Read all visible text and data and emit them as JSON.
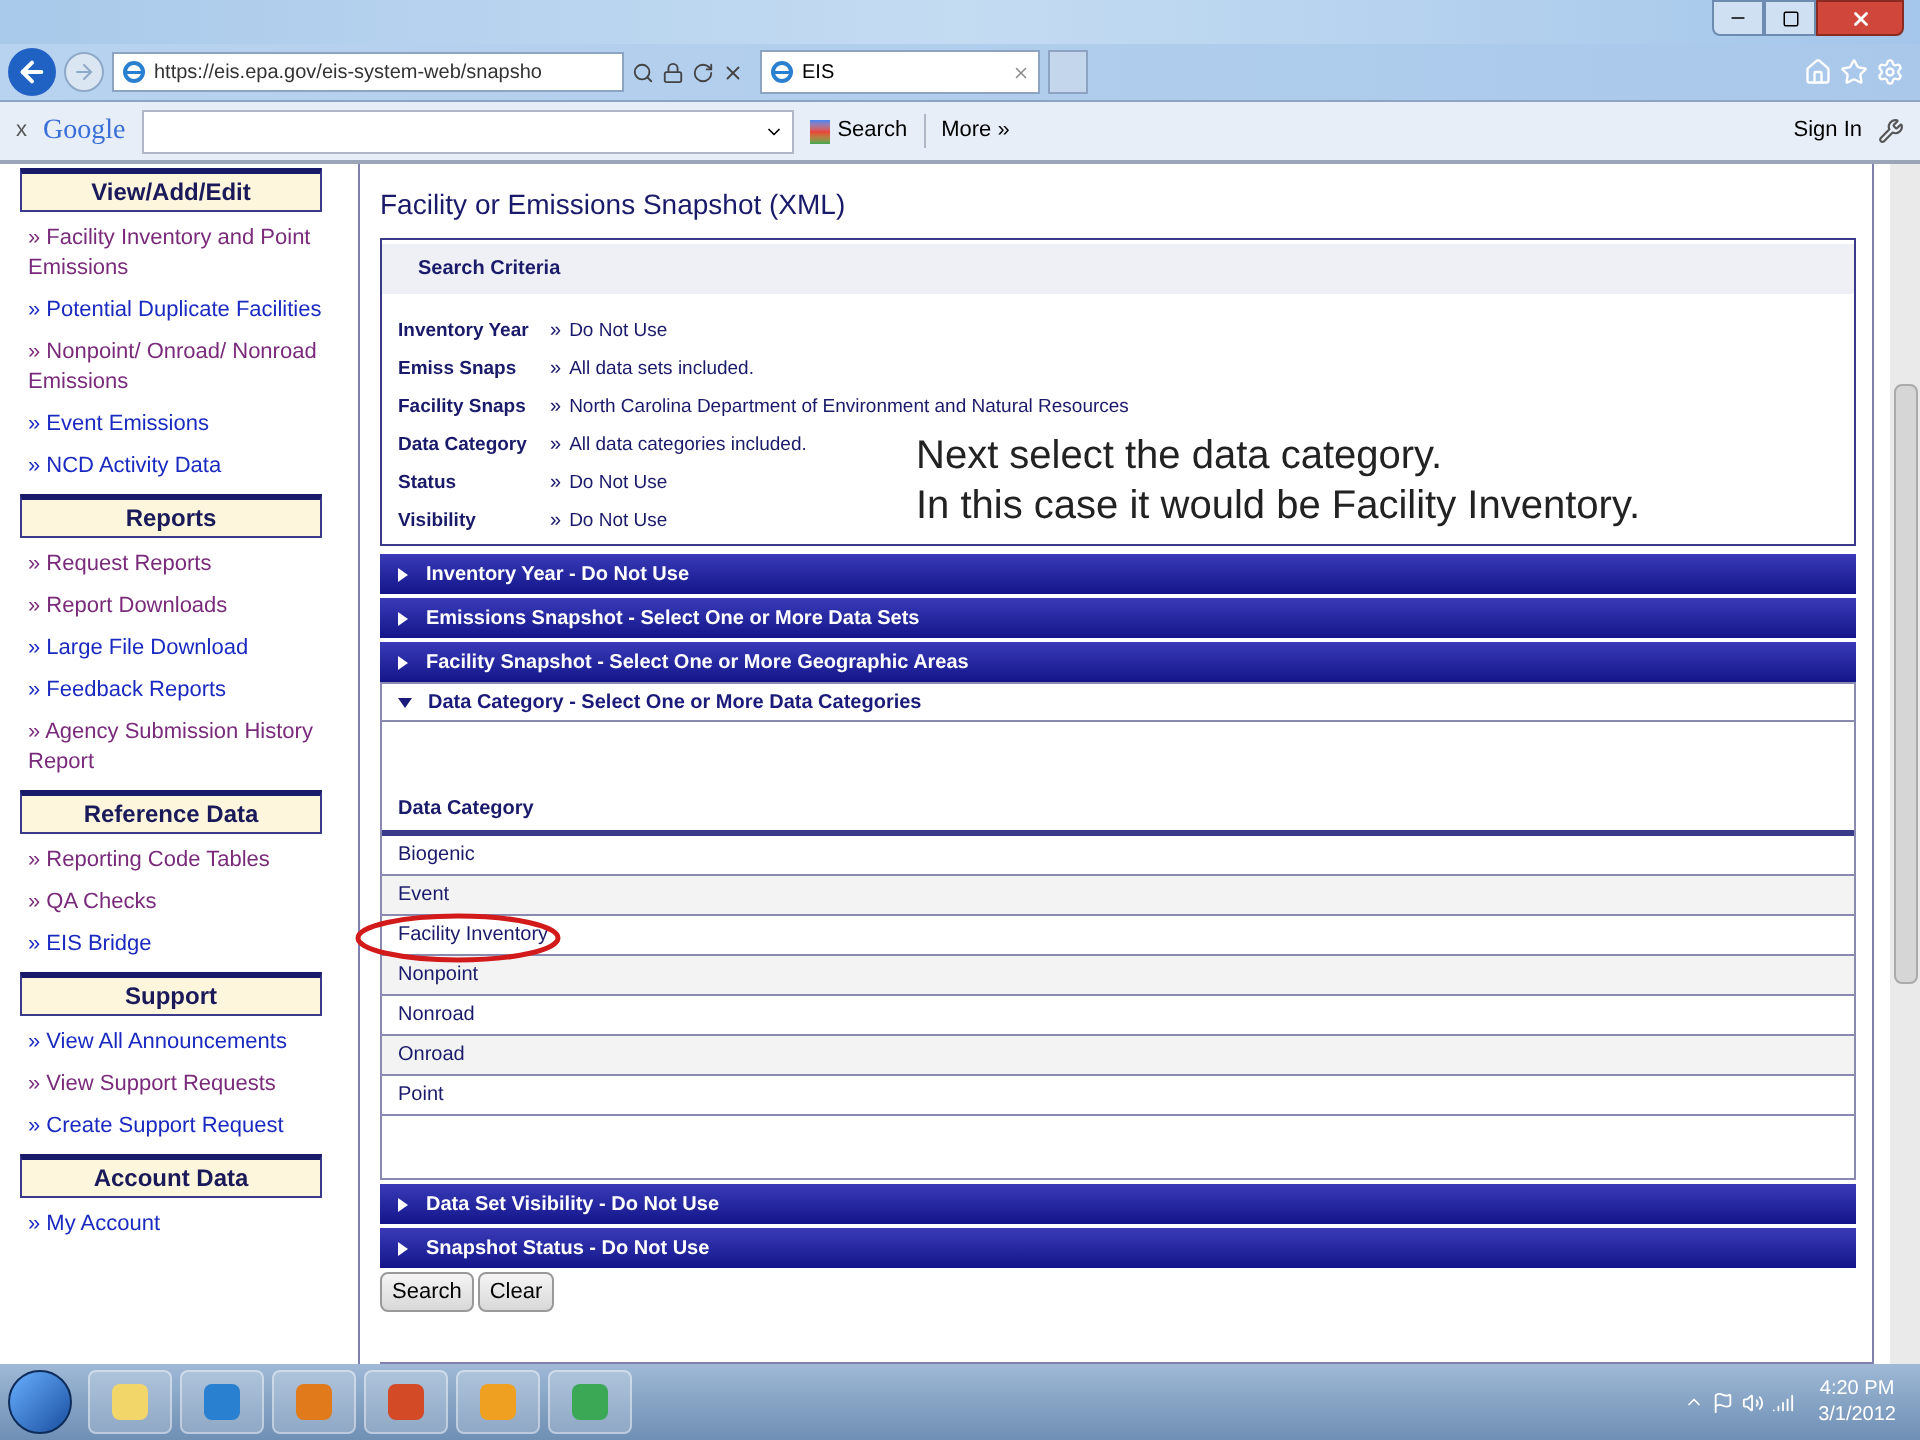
{
  "browser": {
    "address": "https://eis.epa.gov/eis-system-web/snapsho",
    "tab_title": "EIS",
    "toolbar_close": "x",
    "google_label": "Google",
    "search_button": "Search",
    "more_button": "More »",
    "sign_in": "Sign In"
  },
  "sidebar": [
    {
      "title": "View/Add/Edit",
      "links": [
        {
          "label": "» Facility Inventory and Point Emissions",
          "visited": true
        },
        {
          "label": "» Potential Duplicate Facilities",
          "visited": false
        },
        {
          "label": "» Nonpoint/ Onroad/ Nonroad Emissions",
          "visited": true
        },
        {
          "label": "» Event Emissions",
          "visited": false
        },
        {
          "label": "» NCD Activity Data",
          "visited": false
        }
      ]
    },
    {
      "title": "Reports",
      "links": [
        {
          "label": "» Request Reports",
          "visited": true
        },
        {
          "label": "» Report Downloads",
          "visited": true
        },
        {
          "label": "» Large File Download",
          "visited": false
        },
        {
          "label": "» Feedback Reports",
          "visited": false
        },
        {
          "label": "» Agency Submission History Report",
          "visited": true
        }
      ]
    },
    {
      "title": "Reference Data",
      "links": [
        {
          "label": "» Reporting Code Tables",
          "visited": true
        },
        {
          "label": "» QA Checks",
          "visited": true
        },
        {
          "label": "» EIS Bridge",
          "visited": false
        }
      ]
    },
    {
      "title": "Support",
      "links": [
        {
          "label": "» View All Announcements",
          "visited": false
        },
        {
          "label": "» View Support Requests",
          "visited": true
        },
        {
          "label": "» Create Support Request",
          "visited": false
        }
      ]
    },
    {
      "title": "Account Data",
      "links": [
        {
          "label": "» My Account",
          "visited": false
        }
      ]
    }
  ],
  "page_title": "Facility or Emissions Snapshot (XML)",
  "search_criteria": {
    "title": "Search Criteria",
    "bullet": "»",
    "rows": [
      {
        "label": "Inventory Year",
        "value": "Do Not Use"
      },
      {
        "label": "Emiss Snaps",
        "value": "All data sets included."
      },
      {
        "label": "Facility Snaps",
        "value": "North Carolina Department of Environment and Natural Resources"
      },
      {
        "label": "Data Category",
        "value": "All data categories included."
      },
      {
        "label": "Status",
        "value": "Do Not Use"
      },
      {
        "label": "Visibility",
        "value": "Do Not Use"
      }
    ]
  },
  "annotation": [
    "Next select the data category.",
    "In this case it would be Facility Inventory."
  ],
  "sections": [
    {
      "title": "Inventory Year - Do Not Use",
      "expanded": false
    },
    {
      "title": "Emissions Snapshot - Select One or More Data Sets",
      "expanded": false
    },
    {
      "title": "Facility Snapshot - Select One or More Geographic Areas",
      "expanded": false
    },
    {
      "title": "Data Category - Select One or More Data Categories",
      "expanded": true
    },
    {
      "title": "Data Set Visibility - Do Not Use",
      "expanded": false
    },
    {
      "title": "Snapshot Status - Do Not Use",
      "expanded": false
    }
  ],
  "data_category_table": {
    "column": "Data Category",
    "rows": [
      {
        "label": "Biogenic",
        "circled": false
      },
      {
        "label": "Event",
        "circled": false
      },
      {
        "label": "Facility Inventory",
        "circled": true
      },
      {
        "label": "Nonpoint",
        "circled": false
      },
      {
        "label": "Nonroad",
        "circled": false
      },
      {
        "label": "Onroad",
        "circled": false
      },
      {
        "label": "Point",
        "circled": false
      }
    ]
  },
  "buttons": [
    "Search",
    "Clear"
  ],
  "taskbar": {
    "time": "4:20 PM",
    "date": "3/1/2012"
  }
}
